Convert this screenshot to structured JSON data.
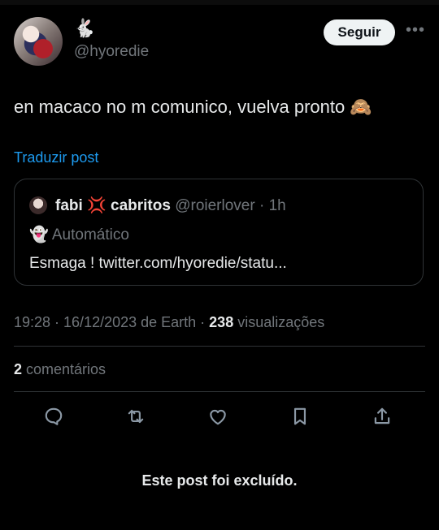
{
  "author": {
    "name_emoji": "🐇",
    "handle": "@hyoredie"
  },
  "follow_button": {
    "label": "Seguir"
  },
  "more_icon": "more-horizontal-icon",
  "post": {
    "text": "en macaco no m comunico, vuelva pronto 🙈",
    "translate_label": "Traduzir post"
  },
  "quote": {
    "name_part1": "fabi ",
    "anger_emoji": "💢",
    "name_part2": " cabritos",
    "handle_time": " @roierlover · 1h",
    "automated_label": "👻 Automático",
    "text": "Esmaga ! twitter.com/hyoredie/statu..."
  },
  "meta": {
    "time_date": "19:28 · 16/12/2023 de Earth · ",
    "views_count": "238",
    "views_label": " visualizações"
  },
  "comments": {
    "count": "2",
    "label": " comentários"
  },
  "actions": [
    "reply-icon",
    "repost-icon",
    "like-icon",
    "bookmark-icon",
    "share-icon"
  ],
  "deleted_notice": "Este post foi excluído.",
  "colors": {
    "background": "#000000",
    "link": "#1d9bf0",
    "muted": "#71767b",
    "text": "#e7e9ea"
  }
}
